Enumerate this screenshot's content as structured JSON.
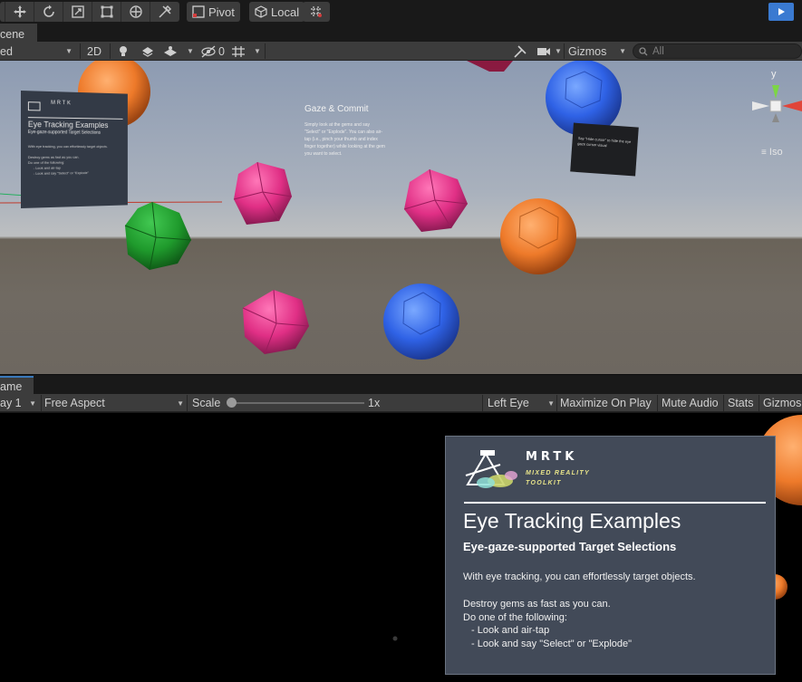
{
  "toolbar": {
    "pivot_label": "Pivot",
    "local_label": "Local",
    "tools": [
      "hand-tool-icon",
      "move-tool-icon",
      "rotate-tool-icon",
      "scale-tool-icon",
      "rect-tool-icon",
      "transform-tool-icon",
      "custom-tool-icon"
    ],
    "accent_color": "#3a7ad1"
  },
  "scene_tab": {
    "label": "cene"
  },
  "scene_toolbar": {
    "draw_mode_label": "ed",
    "mode_2d_label": "2D",
    "hidden_count": "0",
    "gizmos_label": "Gizmos",
    "search_placeholder": "All"
  },
  "scene_view": {
    "gaze_title": "Gaze & Commit",
    "gaze_body": "Simply look at the gems and say \"Select\" or \"Explode\". You can also air-tap (i.e., pinch your thumb and index finger together) while looking at the gem you want to select.",
    "mini_panel": {
      "wordmark": "MRTK",
      "title": "Eye Tracking Examples",
      "subtitle": "Eye-gaze-supported Target Selections",
      "intro": "With eye tracking, you can effortlessly target objects.",
      "lines": [
        "Destroy gems as fast as you can.",
        "Do one of the following:",
        "- Look and air-tap",
        "- Look and say \"Select\" or \"Explode\""
      ]
    },
    "voice_panel_text": "Say \"Hide cursor\" to hide the eye gaze cursor visual",
    "gizmo_y_label": "y",
    "gizmo_iso_label": "Iso"
  },
  "game_tab": {
    "label": "ame"
  },
  "game_toolbar": {
    "display_label": "ay 1",
    "aspect_label": "Free Aspect",
    "scale_label": "Scale",
    "scale_value": "1x",
    "scale_fraction": 0.0,
    "eye_label": "Left Eye",
    "maximize_label": "Maximize On Play",
    "mute_label": "Mute Audio",
    "stats_label": "Stats",
    "gizmos_label": "Gizmos"
  },
  "game_panel": {
    "wordmark": "MRTK",
    "tagline_1": "MIXED REALITY",
    "tagline_2": "TOOLKIT",
    "title": "Eye Tracking Examples",
    "subtitle": "Eye-gaze-supported Target Selections",
    "intro": "With eye tracking, you can effortlessly target objects.",
    "line_1": "Destroy gems as fast as you can.",
    "line_2": "Do one of the following:",
    "bullet_1": "-   Look and air-tap",
    "bullet_2": "-   Look and say \"Select\" or \"Explode\""
  }
}
